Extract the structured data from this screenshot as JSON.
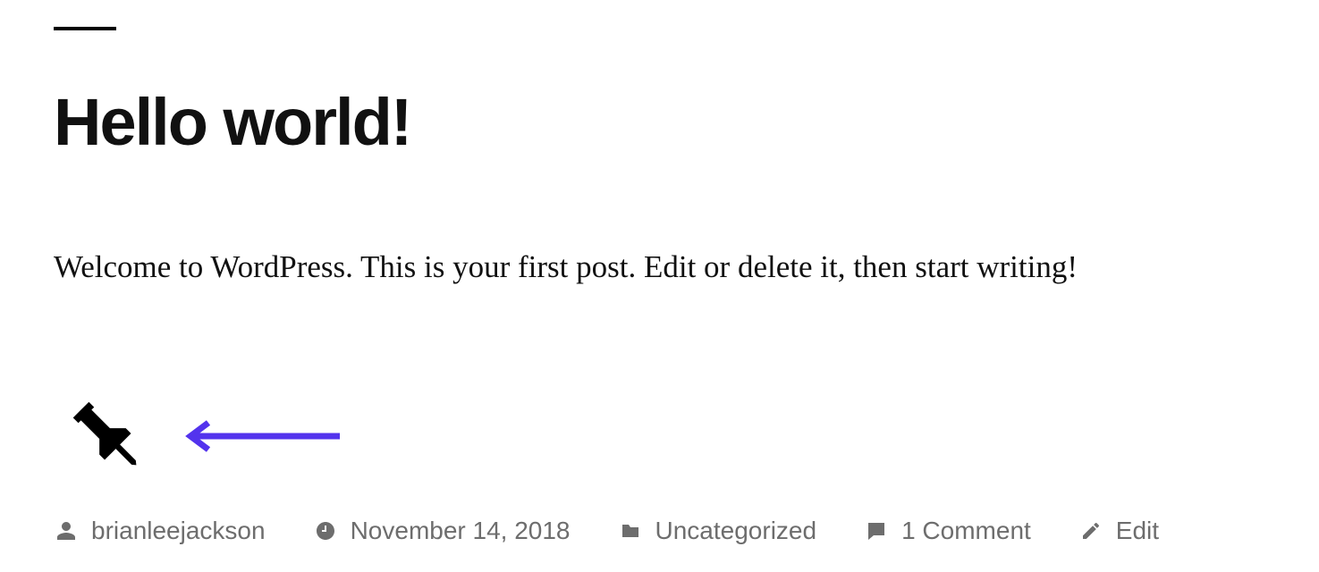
{
  "post": {
    "title": "Hello world!",
    "excerpt": "Welcome to WordPress. This is your first post. Edit or delete it, then start writing!"
  },
  "meta": {
    "author": "brianleejackson",
    "date": "November 14, 2018",
    "category": "Uncategorized",
    "comments_label": "1 Comment",
    "edit_label": "Edit"
  },
  "annotation": {
    "arrow_color": "#5333ed"
  }
}
